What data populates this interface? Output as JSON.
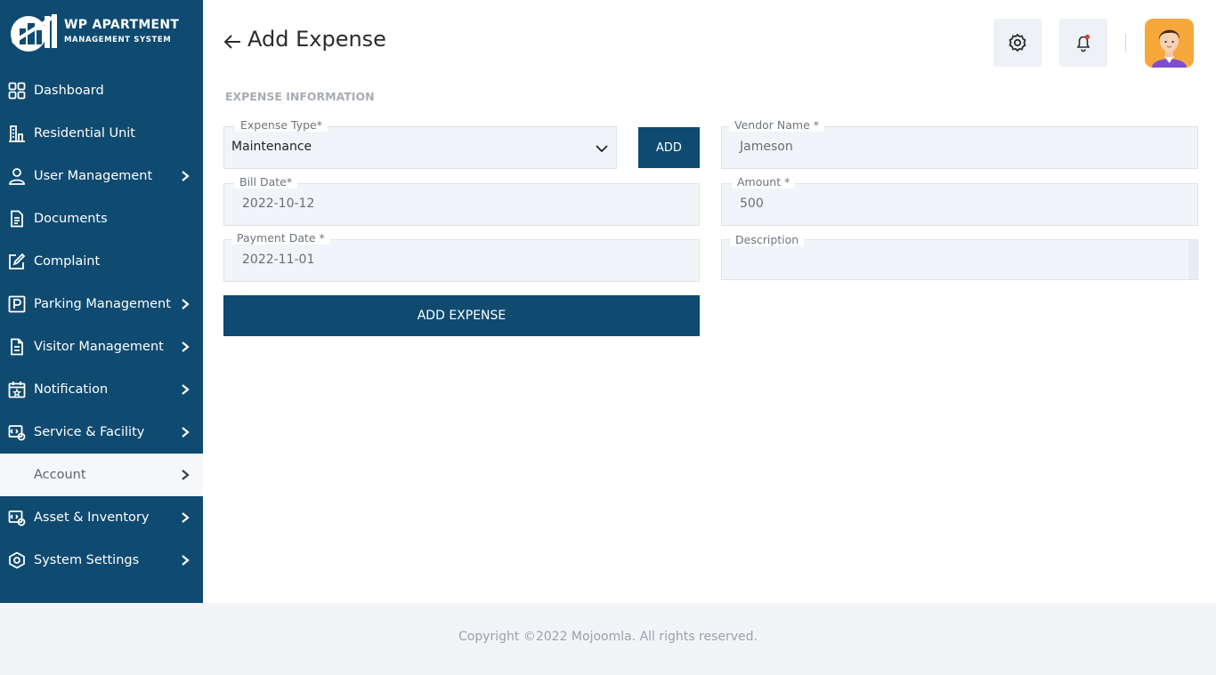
{
  "app": {
    "logo_title": "WP APARTMENT",
    "logo_subtitle": "MANAGEMENT SYSTEM"
  },
  "sidebar": {
    "items": [
      {
        "label": "Dashboard",
        "icon": "dashboard-grid-icon",
        "has_chevron": false
      },
      {
        "label": "Residential Unit",
        "icon": "building-icon",
        "has_chevron": false
      },
      {
        "label": "User Management",
        "icon": "user-icon",
        "has_chevron": true
      },
      {
        "label": "Documents",
        "icon": "document-icon",
        "has_chevron": false
      },
      {
        "label": "Complaint",
        "icon": "edit-icon",
        "has_chevron": false
      },
      {
        "label": "Parking Management",
        "icon": "parking-icon",
        "has_chevron": true
      },
      {
        "label": "Visitor Management",
        "icon": "file-icon",
        "has_chevron": true
      },
      {
        "label": "Notification",
        "icon": "calendar-star-icon",
        "has_chevron": true
      },
      {
        "label": "Service & Facility",
        "icon": "service-icon",
        "has_chevron": true
      },
      {
        "label": "Account",
        "icon": "account-icon",
        "has_chevron": true,
        "active": true
      },
      {
        "label": "Asset & Inventory",
        "icon": "asset-icon",
        "has_chevron": true
      },
      {
        "label": "System Settings",
        "icon": "settings-eye-icon",
        "has_chevron": true
      }
    ]
  },
  "header": {
    "title": "Add Expense",
    "back_icon": "arrow-left-icon",
    "settings_icon": "gear-icon",
    "notification_icon": "bell-icon"
  },
  "form": {
    "section_title": "EXPENSE INFORMATION",
    "expense_type": {
      "label": "Expense Type*",
      "value": "Maintenance"
    },
    "add_button": "ADD",
    "vendor_name": {
      "label": "Vendor Name *",
      "value": "Jameson"
    },
    "bill_date": {
      "label": "Bill Date*",
      "value": "2022-10-12"
    },
    "amount": {
      "label": "Amount *",
      "value": "500"
    },
    "payment_date": {
      "label": "Payment Date *",
      "value": "2022-11-01"
    },
    "description": {
      "label": "Description",
      "value": ""
    },
    "submit_button": "ADD EXPENSE"
  },
  "footer": {
    "text": "Copyright ©2022 Mojoomla. All rights reserved."
  },
  "colors": {
    "primary": "#0f4a70",
    "field_bg": "#f1f4f9",
    "footer_bg": "#f2f4f8",
    "notification_dot": "#e53935",
    "avatar_bg": "#f7a83a"
  }
}
